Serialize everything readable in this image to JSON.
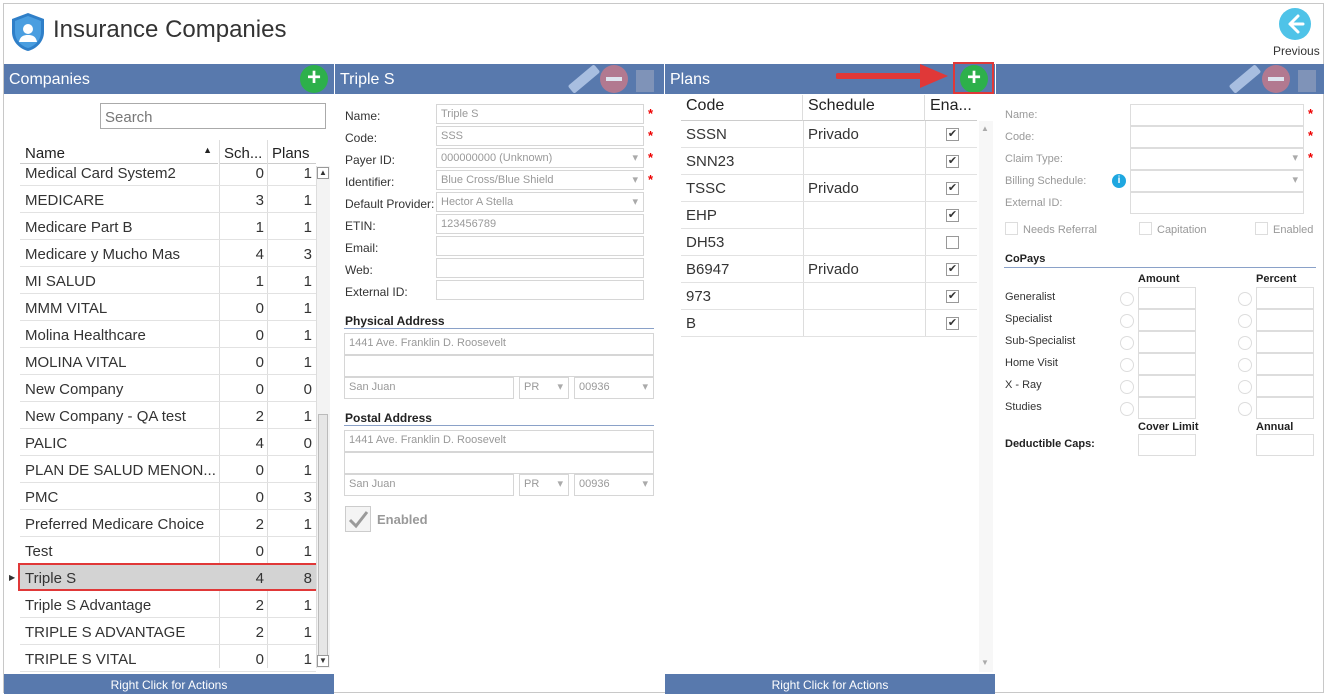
{
  "header": {
    "title": "Insurance Companies",
    "previous_label": "Previous"
  },
  "companies_panel": {
    "title": "Companies",
    "search_placeholder": "Search",
    "columns": {
      "name": "Name",
      "schedules": "Sch...",
      "plans": "Plans"
    },
    "rows": [
      {
        "name": "Medical Card System2",
        "sch": "0",
        "plans": "1"
      },
      {
        "name": "MEDICARE",
        "sch": "3",
        "plans": "1"
      },
      {
        "name": "Medicare Part B",
        "sch": "1",
        "plans": "1"
      },
      {
        "name": "Medicare y Mucho Mas",
        "sch": "4",
        "plans": "3"
      },
      {
        "name": "MI SALUD",
        "sch": "1",
        "plans": "1"
      },
      {
        "name": "MMM VITAL",
        "sch": "0",
        "plans": "1"
      },
      {
        "name": "Molina Healthcare",
        "sch": "0",
        "plans": "1"
      },
      {
        "name": "MOLINA VITAL",
        "sch": "0",
        "plans": "1"
      },
      {
        "name": "New Company",
        "sch": "0",
        "plans": "0"
      },
      {
        "name": "New Company - QA test",
        "sch": "2",
        "plans": "1"
      },
      {
        "name": "PALIC",
        "sch": "4",
        "plans": "0"
      },
      {
        "name": "PLAN DE SALUD MENON...",
        "sch": "0",
        "plans": "1"
      },
      {
        "name": "PMC",
        "sch": "0",
        "plans": "3"
      },
      {
        "name": "Preferred Medicare Choice",
        "sch": "2",
        "plans": "1"
      },
      {
        "name": "Test",
        "sch": "0",
        "plans": "1"
      },
      {
        "name": "Triple S",
        "sch": "4",
        "plans": "8"
      },
      {
        "name": "Triple S Advantage",
        "sch": "2",
        "plans": "1"
      },
      {
        "name": "TRIPLE S ADVANTAGE",
        "sch": "2",
        "plans": "1"
      },
      {
        "name": "TRIPLE S VITAL",
        "sch": "0",
        "plans": "1"
      }
    ],
    "footer": "Right Click for Actions"
  },
  "company_detail": {
    "title": "Triple S",
    "labels": {
      "name": "Name:",
      "code": "Code:",
      "payer_id": "Payer ID:",
      "identifier": "Identifier:",
      "default_provider": "Default Provider:",
      "etin": "ETIN:",
      "email": "Email:",
      "web": "Web:",
      "external_id": "External ID:"
    },
    "values": {
      "name": "Triple S",
      "code": "SSS",
      "payer_id": "000000000 (Unknown)",
      "identifier": "Blue Cross/Blue Shield",
      "default_provider": "Hector A Stella",
      "etin": "123456789",
      "email": "",
      "web": "",
      "external_id": ""
    },
    "physical_address": {
      "title": "Physical Address",
      "line1": "1441 Ave. Franklin D. Roosevelt",
      "line2": "",
      "city": "San Juan",
      "state": "PR",
      "zip": "00936"
    },
    "postal_address": {
      "title": "Postal Address",
      "line1": "1441 Ave. Franklin D. Roosevelt",
      "line2": "",
      "city": "San Juan",
      "state": "PR",
      "zip": "00936"
    },
    "enabled_label": "Enabled"
  },
  "plans_panel": {
    "title": "Plans",
    "columns": {
      "code": "Code",
      "schedule": "Schedule",
      "enabled": "Ena..."
    },
    "rows": [
      {
        "code": "SSSN",
        "schedule": "Privado",
        "enabled": "✔"
      },
      {
        "code": "SNN23",
        "schedule": "",
        "enabled": "✔"
      },
      {
        "code": "TSSC",
        "schedule": "Privado",
        "enabled": "✔"
      },
      {
        "code": "EHP",
        "schedule": "",
        "enabled": "✔"
      },
      {
        "code": "DH53",
        "schedule": "",
        "enabled": ""
      },
      {
        "code": "B6947",
        "schedule": "Privado",
        "enabled": "✔"
      },
      {
        "code": "973",
        "schedule": "",
        "enabled": "✔"
      },
      {
        "code": "B",
        "schedule": "",
        "enabled": "✔"
      }
    ],
    "footer": "Right Click for Actions"
  },
  "plan_detail": {
    "labels": {
      "name": "Name:",
      "code": "Code:",
      "claim_type": "Claim Type:",
      "billing_schedule": "Billing Schedule:",
      "external_id": "External ID:"
    },
    "checkboxes": {
      "needs_referral": "Needs Referral",
      "capitation": "Capitation",
      "enabled": "Enabled"
    },
    "copays": {
      "title": "CoPays",
      "amount_header": "Amount",
      "percent_header": "Percent",
      "items": [
        "Generalist",
        "Specialist",
        "Sub-Specialist",
        "Home Visit",
        "X - Ray",
        "Studies"
      ],
      "cover_limit_header": "Cover Limit",
      "annual_header": "Annual",
      "deductible_label": "Deductible Caps:"
    }
  },
  "colors": {
    "panel_header": "#5879ad",
    "accent_add": "#2db04b",
    "highlight": "#e03838"
  }
}
